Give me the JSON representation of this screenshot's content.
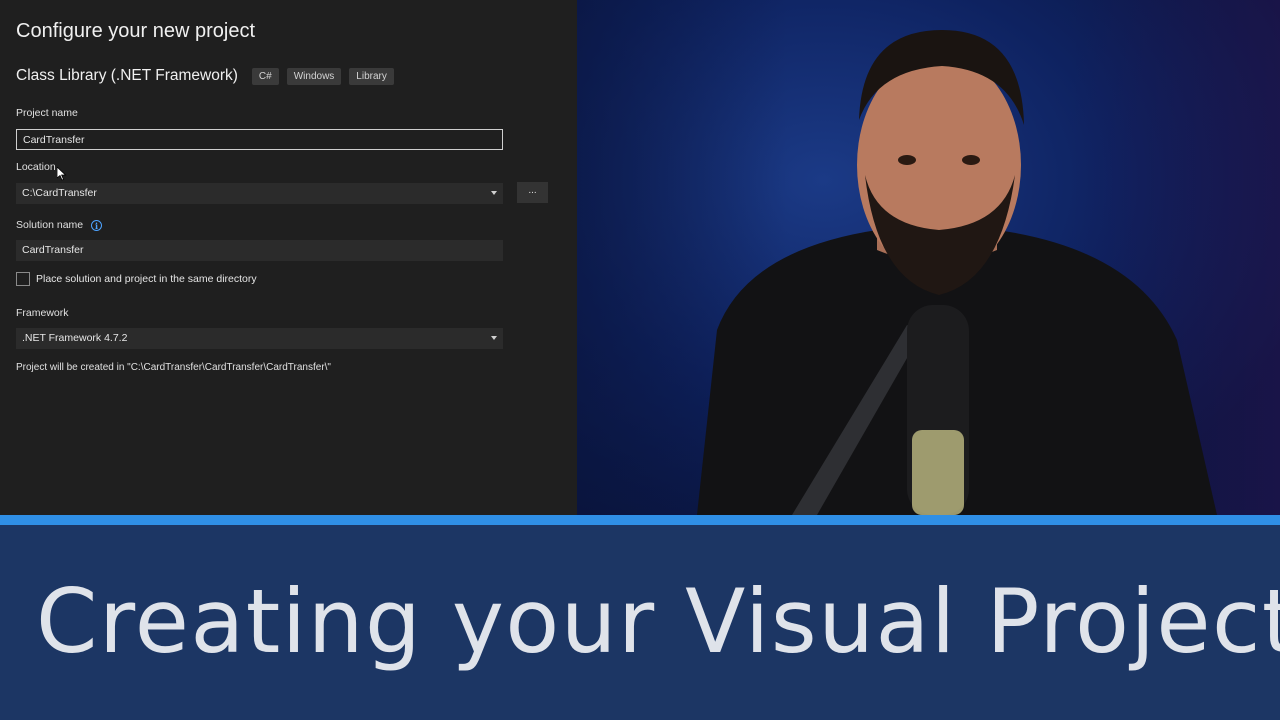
{
  "dialog": {
    "title": "Configure your new project",
    "template_name": "Class Library (.NET Framework)",
    "tags": [
      "C#",
      "Windows",
      "Library"
    ],
    "project_name_label": "Project name",
    "project_name_value": "CardTransfer",
    "location_label": "Location",
    "location_value": "C:\\CardTransfer",
    "browse_label": "...",
    "solution_name_label": "Solution name",
    "solution_name_value": "CardTransfer",
    "same_dir_label": "Place solution and project in the same directory",
    "framework_label": "Framework",
    "framework_value": ".NET Framework 4.7.2",
    "path_note": "Project will be created in \"C:\\CardTransfer\\CardTransfer\\CardTransfer\\\""
  },
  "banner": {
    "title": "Creating your Visual Project"
  },
  "colors": {
    "panel_bg": "#1f1f1f",
    "stripe": "#2f8fe6",
    "banner_bg": "#1c3664",
    "info_accent": "#4da3ff"
  }
}
